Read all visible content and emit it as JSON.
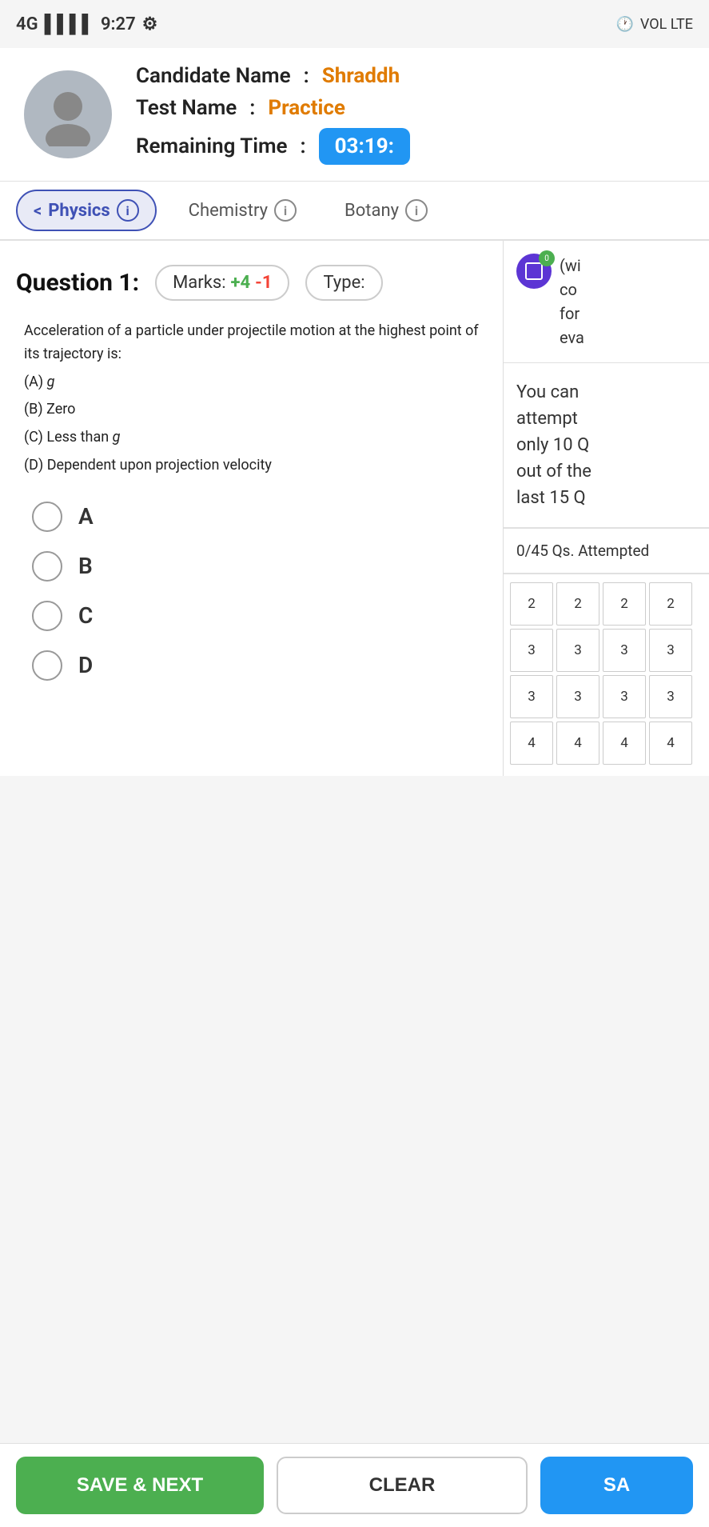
{
  "statusBar": {
    "signal": "4G",
    "time": "9:27",
    "settingsIcon": "gear-icon",
    "alarmIcon": "alarm-icon",
    "networkText": "VOL LTE"
  },
  "header": {
    "candidateLabel": "Candidate Name",
    "candidateValue": "Shraddh",
    "testLabel": "Test Name",
    "testValue": "Practice",
    "timeLabel": "Remaining Time",
    "timeValue": "03:19:",
    "colon": ":"
  },
  "tabs": [
    {
      "id": "physics",
      "label": "Physics",
      "active": true
    },
    {
      "id": "chemistry",
      "label": "Chemistry",
      "active": false
    },
    {
      "id": "botany",
      "label": "Botany",
      "active": false
    }
  ],
  "question": {
    "title": "Question 1:",
    "marksLabel": "Marks:",
    "marksPositive": "+4",
    "marksNegative": "-1",
    "typeLabel": "Type:",
    "body": "Acceleration of a particle under projectile motion at the highest point of its trajectory is:",
    "options": [
      {
        "id": "A",
        "text": "(A) g"
      },
      {
        "id": "B",
        "text": "(B) Zero"
      },
      {
        "id": "C",
        "text": "(C) Less than g"
      },
      {
        "id": "D",
        "text": "(D) Dependent upon projection velocity"
      }
    ],
    "answerChoices": [
      "A",
      "B",
      "C",
      "D"
    ]
  },
  "sidebar": {
    "notifBadge": "0",
    "notifText": "(wi\nco\nfor\neva",
    "infoText": "You can attempt only 10 Q out of the last 15 Q",
    "progressText": "0/45 Qs. Attempted",
    "questionNumbers": [
      [
        "2",
        "2",
        "2",
        "2"
      ],
      [
        "3",
        "3",
        "3",
        "3"
      ],
      [
        "3",
        "3",
        "3",
        "3"
      ],
      [
        "4",
        "4",
        "4",
        "4"
      ]
    ]
  },
  "bottomBar": {
    "saveNextLabel": "SAVE & NEXT",
    "clearLabel": "CLEAR",
    "saveLabel": "SA"
  }
}
